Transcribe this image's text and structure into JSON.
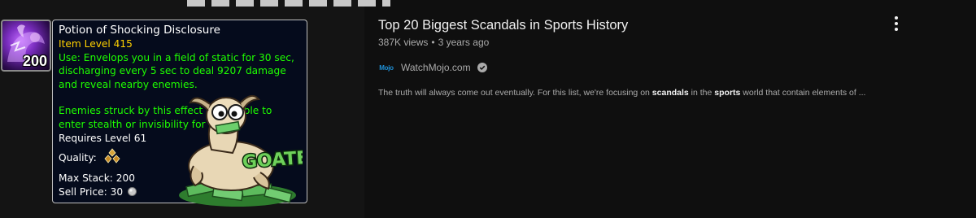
{
  "item_tooltip": {
    "icon": "potion-icon",
    "stack_count": "200",
    "name": "Potion of Shocking Disclosure",
    "item_level": "Item Level 415",
    "use_text": "Use: Envelops you in a field of static for 30 sec, discharging every 5 sec to deal 9207 damage and reveal nearby enemies.",
    "effect_text": "Enemies struck by this effect are unable to enter stealth or invisibility for 6 sec.",
    "requires_level": "Requires Level 61",
    "quality_label": "Quality:",
    "max_stack": "Max Stack: 200",
    "sell_price_label": "Sell Price: 30",
    "coin_icon": "silver-coin-icon",
    "colors": {
      "name": "#ffffff",
      "item_level": "#ffd100",
      "use": "#1eff00",
      "background": "#050b1c"
    }
  },
  "sticker": {
    "text": "GOATED",
    "icon": "goat-sticker-icon"
  },
  "video": {
    "title": "Top 20 Biggest Scandals in Sports History",
    "views": "387K views",
    "dot": "•",
    "age": "3 years ago",
    "channel_logo": "Mojo",
    "channel": "WatchMojo.com",
    "verified_icon": "verified-check-icon",
    "description_parts": [
      "The truth will always come out eventually. For this list, we're focusing on ",
      "scandals",
      " in the ",
      "sports",
      " world that contain elements of ..."
    ],
    "more_icon": "more-vert-icon"
  }
}
